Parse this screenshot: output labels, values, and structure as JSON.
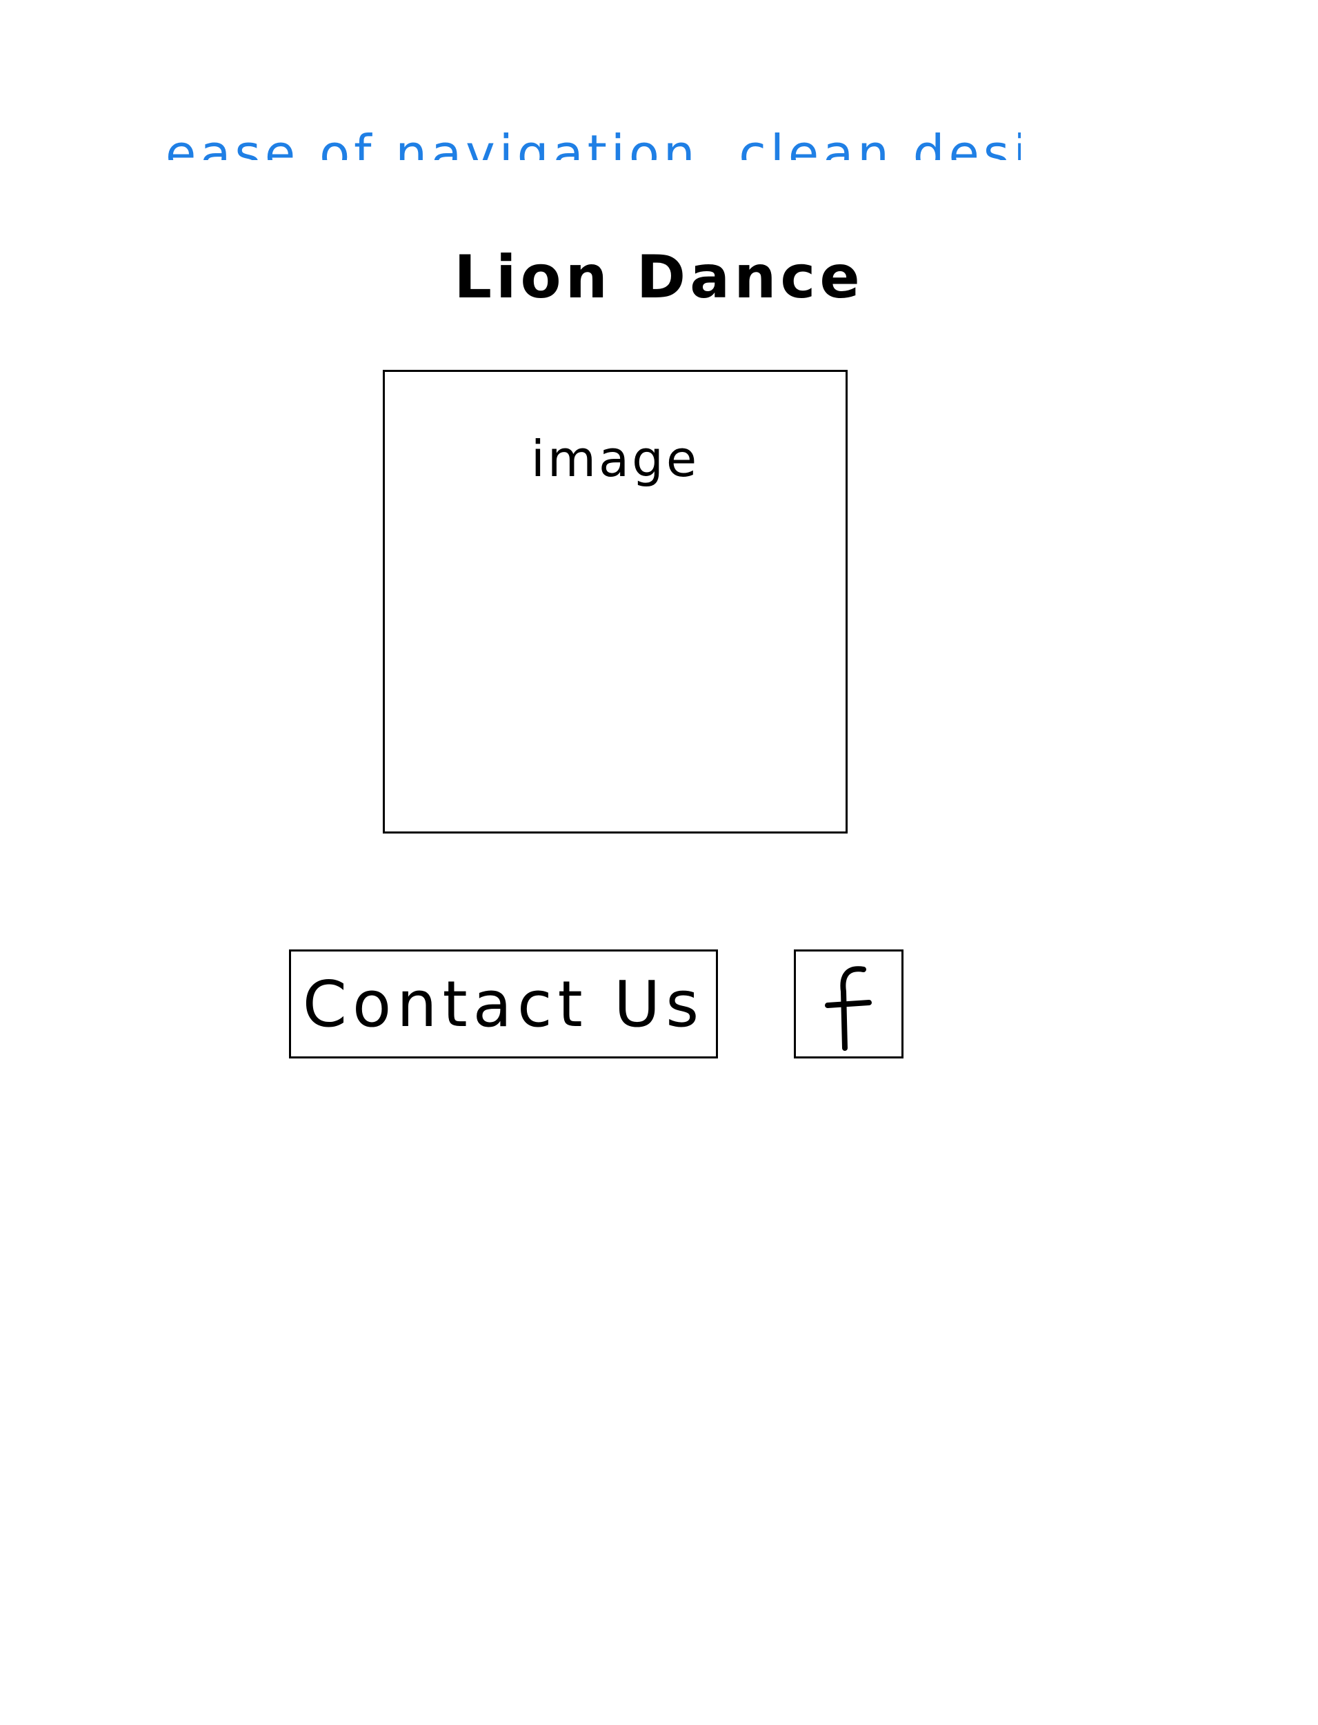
{
  "top_note": {
    "text": "ease of navigation, clean design, accessibility",
    "color": "#1f7fe5"
  },
  "page": {
    "title": "Lion Dance"
  },
  "image_placeholder": {
    "label": "image"
  },
  "footer": {
    "contact_label": "Contact Us",
    "facebook_icon": "facebook-icon"
  }
}
